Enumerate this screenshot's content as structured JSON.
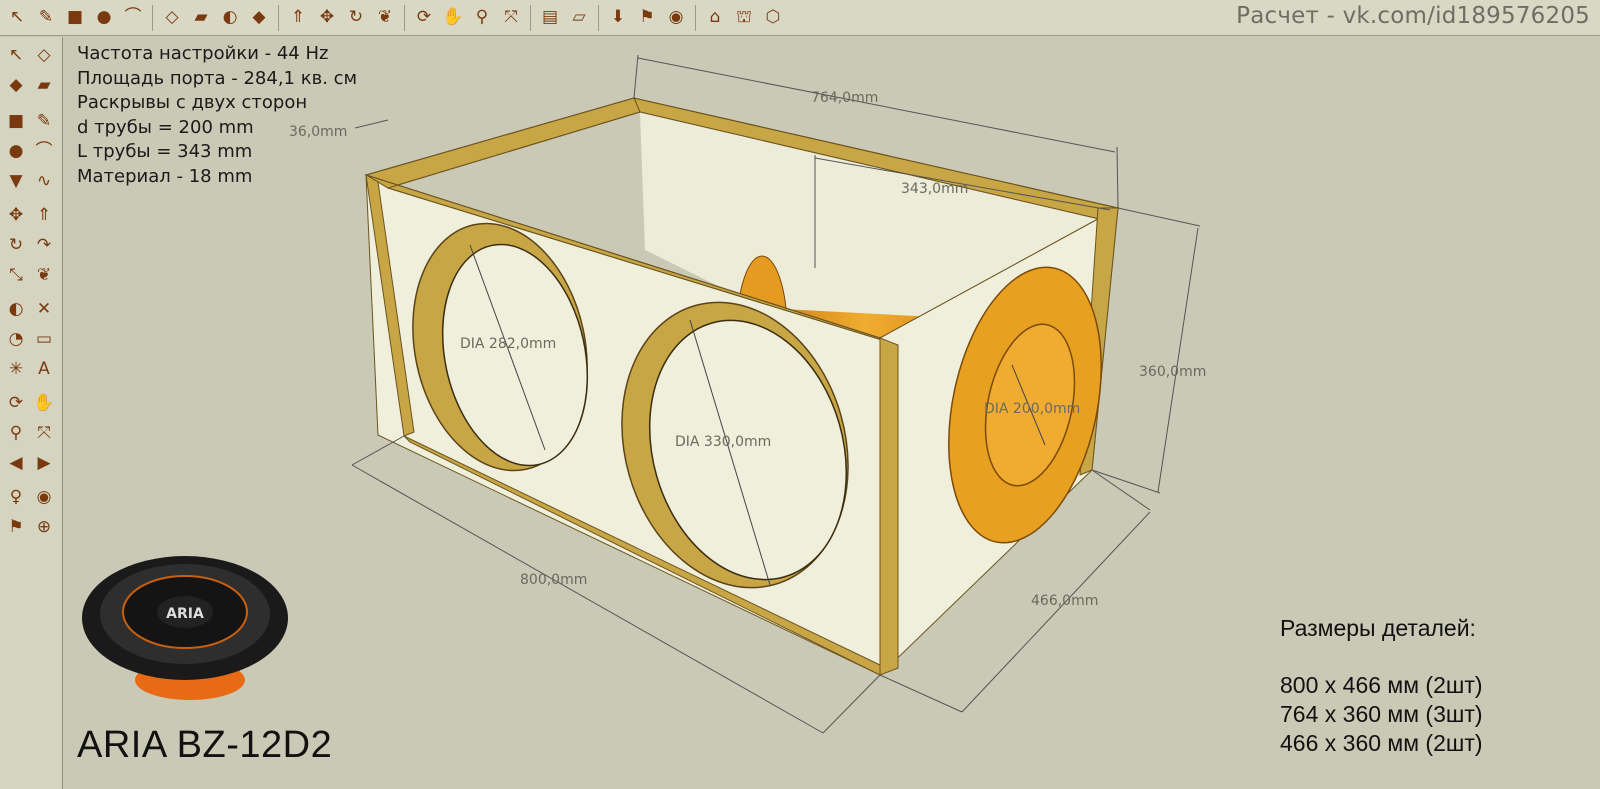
{
  "credit": "Расчет - vk.com/id189576205",
  "specs": {
    "line1": "Частота настройки - 44 Hz",
    "line2": "Площадь порта - 284,1 кв. см",
    "line3": "Раскрывы с двух сторон",
    "line4": "d трубы = 200 mm",
    "line5": "L трубы = 343 mm",
    "line6": "Материал - 18 mm"
  },
  "dimensions": {
    "depth_top": "764,0mm",
    "thickness": "36,0mm",
    "tube_len": "343,0mm",
    "height": "360,0mm",
    "hole1": "DIA 282,0mm",
    "hole2": "DIA 330,0mm",
    "port_dia": "DIA 200,0mm",
    "width": "800,0mm",
    "depth_bottom": "466,0mm"
  },
  "speaker_logo": "ARIA",
  "model": "ARIA BZ-12D2",
  "parts": {
    "title": "Размеры деталей:",
    "p1": "800 x 466 мм (2шт)",
    "p2": "764 x 360 мм (3шт)",
    "p3": "466 x 360 мм (2шт)"
  },
  "colors": {
    "background": "#c9c9b5",
    "panel_face": "#efefdc",
    "wood_edge": "#c9a645",
    "port_orange": "#e8a020"
  },
  "toolbar_top": [
    "select-icon",
    "pencil-icon",
    "rectangle-icon",
    "circle-icon",
    "arc-icon",
    "eraser-icon",
    "paint-icon",
    "tape-icon",
    "paint-bucket-icon",
    "push-pull-icon",
    "move-icon",
    "rotate-icon",
    "follow-me-icon",
    "orbit-icon",
    "pan-icon",
    "zoom-icon",
    "zoom-extents-icon",
    "section-icon",
    "walk-icon",
    "look-icon",
    "position-camera-icon",
    "axes-icon",
    "text-icon",
    "dimension-icon",
    "protractor-icon"
  ],
  "toolbar_left": [
    "select-icon",
    "component-icon",
    "paint-icon",
    "eraser-icon",
    "rectangle-icon",
    "line-icon",
    "circle-icon",
    "arc-icon",
    "polygon-icon",
    "freehand-icon",
    "move-icon",
    "push-pull-icon",
    "rotate-icon",
    "follow-me-icon",
    "scale-icon",
    "offset-icon",
    "tape-icon",
    "dimension-icon",
    "protractor-icon",
    "text-icon",
    "axes-icon",
    "3d-text-icon",
    "orbit-icon",
    "pan-icon",
    "zoom-icon",
    "zoom-window-icon",
    "previous-icon",
    "next-icon",
    "position-camera-icon",
    "look-around-icon",
    "walk-icon",
    "section-icon"
  ]
}
